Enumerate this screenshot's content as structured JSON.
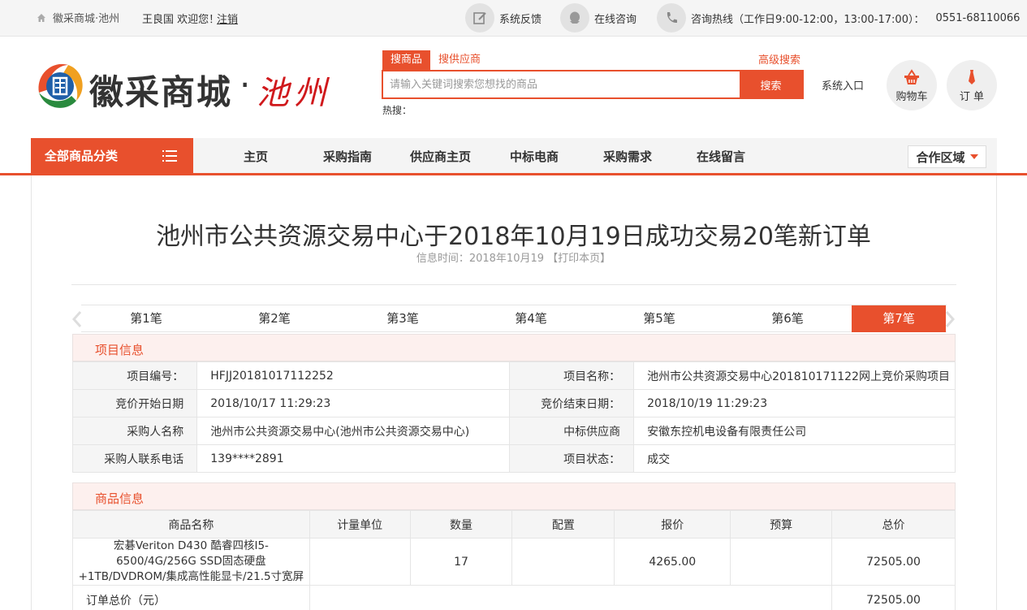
{
  "topbar": {
    "home_label": "徽采商城·池州",
    "user_greeting": "王良国 欢迎您！",
    "logout_label": "注销",
    "feedback_label": "系统反馈",
    "online_consult_label": "在线咨询",
    "hotline_label": "咨询热线（工作日9:00-12:00，13:00-17:00）：",
    "hotline_number": "0551-68110066"
  },
  "header": {
    "logo_text": "徽采商城",
    "logo_dot": "·",
    "logo_city": "池州",
    "search_tab_goods": "搜商品",
    "search_tab_supplier": "搜供应商",
    "advanced_search": "高级搜索",
    "search_placeholder": "请输入关键词搜索您想找的商品",
    "search_button": "搜索",
    "hot_label": "热搜：",
    "system_entry": "系统入口",
    "cart_label": "购物车",
    "order_label": "订 单"
  },
  "nav": {
    "all_categories": "全部商品分类",
    "items": [
      "主页",
      "采购指南",
      "供应商主页",
      "中标电商",
      "采购需求",
      "在线留言"
    ],
    "cooperation": "合作区域"
  },
  "article": {
    "title": "池州市公共资源交易中心于2018年10月19日成功交易20笔新订单",
    "meta": "信息时间：2018年10月19 【打印本页】"
  },
  "order_tabs": [
    "第1笔",
    "第2笔",
    "第3笔",
    "第4笔",
    "第5笔",
    "第6笔",
    "第7笔"
  ],
  "project": {
    "section_title": "项目信息",
    "rows": [
      {
        "l1": "项目编号：",
        "v1": "HFJJ20181017112252",
        "l2": "项目名称：",
        "v2": "池州市公共资源交易中心201810171122网上竞价采购项目"
      },
      {
        "l1": "竞价开始日期",
        "v1": "2018/10/17 11:29:23",
        "l2": "竞价结束日期：",
        "v2": "2018/10/19 11:29:23"
      },
      {
        "l1": "采购人名称",
        "v1": "池州市公共资源交易中心(池州市公共资源交易中心)",
        "l2": "中标供应商",
        "v2": "安徽东控机电设备有限责任公司"
      },
      {
        "l1": "采购人联系电话",
        "v1": "139****2891",
        "l2": "项目状态：",
        "v2": "成交"
      }
    ]
  },
  "goods": {
    "section_title": "商品信息",
    "headers": [
      "商品名称",
      "计量单位",
      "数量",
      "配置",
      "报价",
      "预算",
      "总价"
    ],
    "rows": [
      {
        "name": "宏碁Veriton D430 酷睿四核I5-6500/4G/256G SSD固态硬盘+1TB/DVDROM/集成高性能显卡/21.5寸宽屏",
        "unit": "",
        "qty": "17",
        "config": "",
        "price": "4265.00",
        "budget": "",
        "total": "72505.00"
      }
    ],
    "order_total_label": "订单总价（元）",
    "order_total_value": "72505.00"
  }
}
